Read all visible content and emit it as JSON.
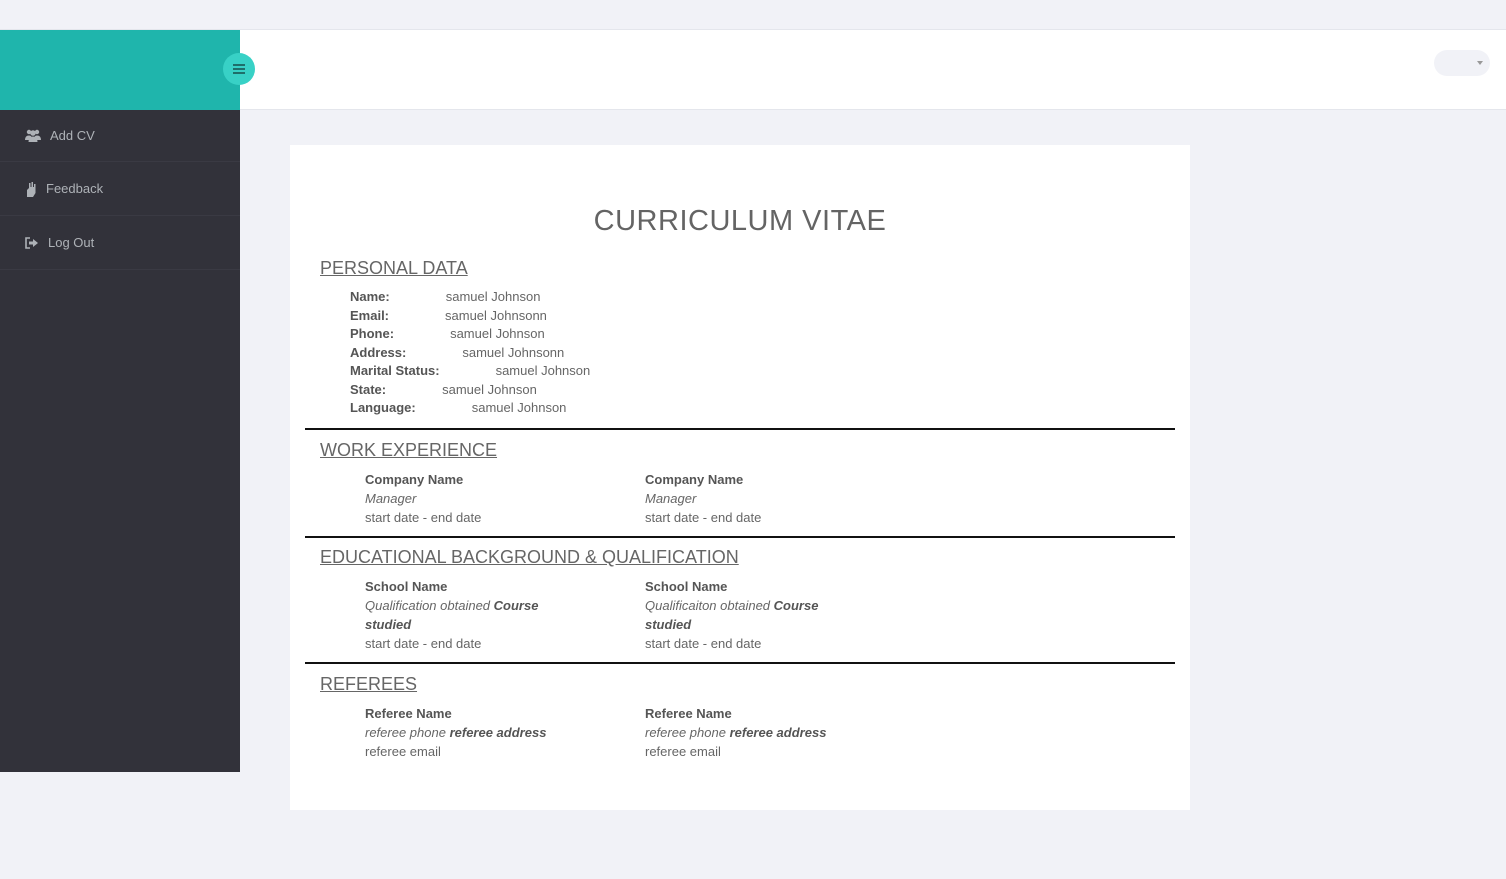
{
  "sidebar": {
    "items": [
      {
        "label": "Add CV",
        "icon": "users-icon"
      },
      {
        "label": "Feedback",
        "icon": "feedback-icon"
      },
      {
        "label": "Log Out",
        "icon": "logout-icon"
      }
    ]
  },
  "colors": {
    "brand": "#1fb5ac",
    "toggle": "#38d1c6",
    "sidebar": "#32323a",
    "background": "#f1f2f7"
  },
  "cv": {
    "title": "CURRICULUM VITAE",
    "personal": {
      "heading": "PERSONAL DATA",
      "fields": [
        {
          "label": "Name:",
          "value": "samuel Johnson"
        },
        {
          "label": "Email:",
          "value": "samuel Johnsonn"
        },
        {
          "label": "Phone:",
          "value": "samuel Johnson"
        },
        {
          "label": "Address:",
          "value": "samuel Johnsonn"
        },
        {
          "label": "Marital Status:",
          "value": "samuel Johnson"
        },
        {
          "label": "State:",
          "value": "samuel Johnson"
        },
        {
          "label": "Language:",
          "value": "samuel Johnson"
        }
      ]
    },
    "work": {
      "heading": "WORK EXPERIENCE",
      "entries": [
        {
          "company": "Company Name",
          "role": "Manager",
          "dates": "start date - end date"
        },
        {
          "company": "Company Name",
          "role": "Manager",
          "dates": "start date - end date"
        }
      ]
    },
    "education": {
      "heading": "EDUCATIONAL BACKGROUND & QUALIFICATION",
      "entries": [
        {
          "school": "School Name",
          "qualification": "Qualification obtained",
          "course": "Course",
          "course2": "studied",
          "dates": "start date - end date"
        },
        {
          "school": "School Name",
          "qualification": "Qualificaiton obtained",
          "course": "Course",
          "course2": "studied",
          "dates": "start date - end date"
        }
      ]
    },
    "referees": {
      "heading": "REFEREES",
      "entries": [
        {
          "name": "Referee Name",
          "phone": "referee phone",
          "address": "referee address",
          "email": "referee email"
        },
        {
          "name": "Referee Name",
          "phone": "referee phone",
          "address": "referee address",
          "email": "referee email"
        }
      ]
    }
  }
}
